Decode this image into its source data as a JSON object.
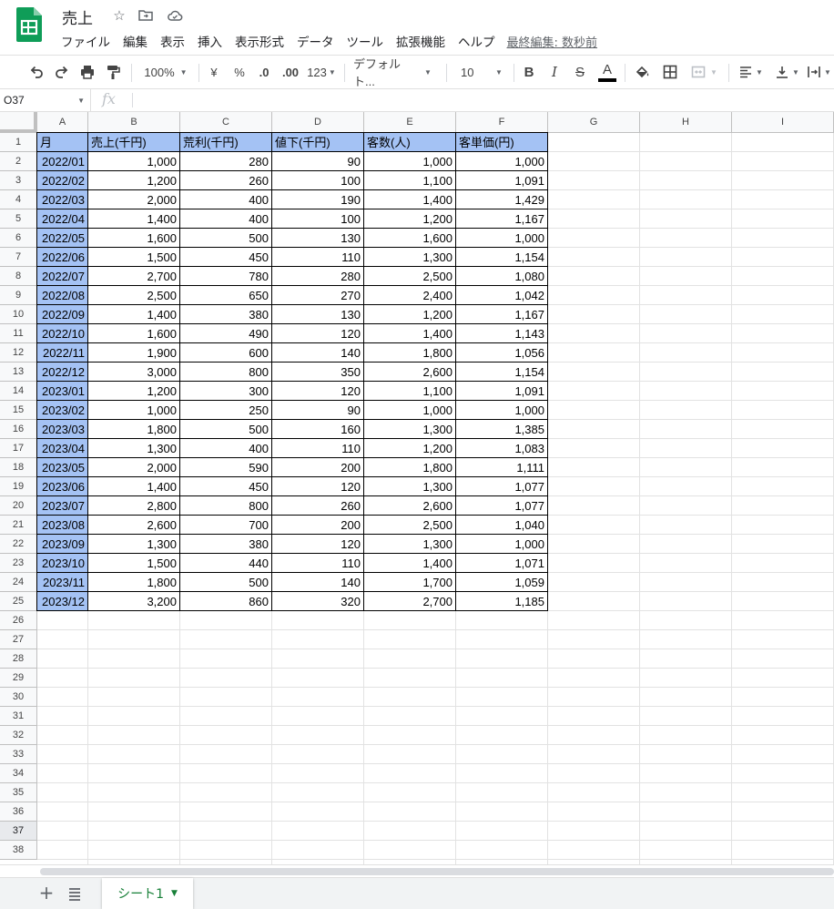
{
  "app": {
    "doc_title": "売上",
    "last_edit": "最終編集: 数秒前",
    "menu": [
      "ファイル",
      "編集",
      "表示",
      "挿入",
      "表示形式",
      "データ",
      "ツール",
      "拡張機能",
      "ヘルプ"
    ]
  },
  "toolbar": {
    "zoom": "100%",
    "currency": "¥",
    "percent": "%",
    "decimal_decrease": ".0",
    "decimal_increase": ".00",
    "number_format": "123",
    "font": "デフォルト...",
    "font_size": "10",
    "bold": "B",
    "italic": "I",
    "strike": "S",
    "text_color_glyph": "A"
  },
  "formula_bar": {
    "name_box": "O37",
    "fx": "fx",
    "value": ""
  },
  "columns": [
    "A",
    "B",
    "C",
    "D",
    "E",
    "F",
    "G",
    "H",
    "I"
  ],
  "rows": [
    "1",
    "2",
    "3",
    "4",
    "5",
    "6",
    "7",
    "8",
    "9",
    "10",
    "11",
    "12",
    "13",
    "14",
    "15",
    "16",
    "17",
    "18",
    "19",
    "20",
    "21",
    "22",
    "23",
    "24",
    "25",
    "26",
    "27",
    "28",
    "29",
    "30",
    "31",
    "32",
    "33",
    "34",
    "35",
    "36",
    "37",
    "38"
  ],
  "selected_row": "37",
  "table": {
    "headers": [
      "月",
      "売上(千円)",
      "荒利(千円)",
      "値下(千円)",
      "客数(人)",
      "客単価(円)"
    ],
    "rows": [
      [
        "2022/01",
        "1,000",
        "280",
        "90",
        "1,000",
        "1,000"
      ],
      [
        "2022/02",
        "1,200",
        "260",
        "100",
        "1,100",
        "1,091"
      ],
      [
        "2022/03",
        "2,000",
        "400",
        "190",
        "1,400",
        "1,429"
      ],
      [
        "2022/04",
        "1,400",
        "400",
        "100",
        "1,200",
        "1,167"
      ],
      [
        "2022/05",
        "1,600",
        "500",
        "130",
        "1,600",
        "1,000"
      ],
      [
        "2022/06",
        "1,500",
        "450",
        "110",
        "1,300",
        "1,154"
      ],
      [
        "2022/07",
        "2,700",
        "780",
        "280",
        "2,500",
        "1,080"
      ],
      [
        "2022/08",
        "2,500",
        "650",
        "270",
        "2,400",
        "1,042"
      ],
      [
        "2022/09",
        "1,400",
        "380",
        "130",
        "1,200",
        "1,167"
      ],
      [
        "2022/10",
        "1,600",
        "490",
        "120",
        "1,400",
        "1,143"
      ],
      [
        "2022/11",
        "1,900",
        "600",
        "140",
        "1,800",
        "1,056"
      ],
      [
        "2022/12",
        "3,000",
        "800",
        "350",
        "2,600",
        "1,154"
      ],
      [
        "2023/01",
        "1,200",
        "300",
        "120",
        "1,100",
        "1,091"
      ],
      [
        "2023/02",
        "1,000",
        "250",
        "90",
        "1,000",
        "1,000"
      ],
      [
        "2023/03",
        "1,800",
        "500",
        "160",
        "1,300",
        "1,385"
      ],
      [
        "2023/04",
        "1,300",
        "400",
        "110",
        "1,200",
        "1,083"
      ],
      [
        "2023/05",
        "2,000",
        "590",
        "200",
        "1,800",
        "1,111"
      ],
      [
        "2023/06",
        "1,400",
        "450",
        "120",
        "1,300",
        "1,077"
      ],
      [
        "2023/07",
        "2,800",
        "800",
        "260",
        "2,600",
        "1,077"
      ],
      [
        "2023/08",
        "2,600",
        "700",
        "200",
        "2,500",
        "1,040"
      ],
      [
        "2023/09",
        "1,300",
        "380",
        "120",
        "1,300",
        "1,000"
      ],
      [
        "2023/10",
        "1,500",
        "440",
        "110",
        "1,400",
        "1,071"
      ],
      [
        "2023/11",
        "1,800",
        "500",
        "140",
        "1,700",
        "1,059"
      ],
      [
        "2023/12",
        "3,200",
        "860",
        "320",
        "2,700",
        "1,185"
      ]
    ]
  },
  "sheets": [
    {
      "name": "シート1",
      "active": true
    }
  ],
  "colors": {
    "header_fill": "#a4c2f4",
    "sheets_green": "#188038",
    "logo_green": "#0f9d58",
    "text_color_bar": "#000000"
  },
  "icons": [
    "undo-icon",
    "redo-icon",
    "print-icon",
    "paint-format-icon",
    "fill-color-icon",
    "borders-icon",
    "merge-cells-icon",
    "align-left-icon",
    "valign-bottom-icon",
    "text-wrap-icon",
    "star-icon",
    "move-folder-icon",
    "cloud-icon",
    "fx-icon",
    "add-sheet-icon",
    "all-sheets-icon"
  ]
}
